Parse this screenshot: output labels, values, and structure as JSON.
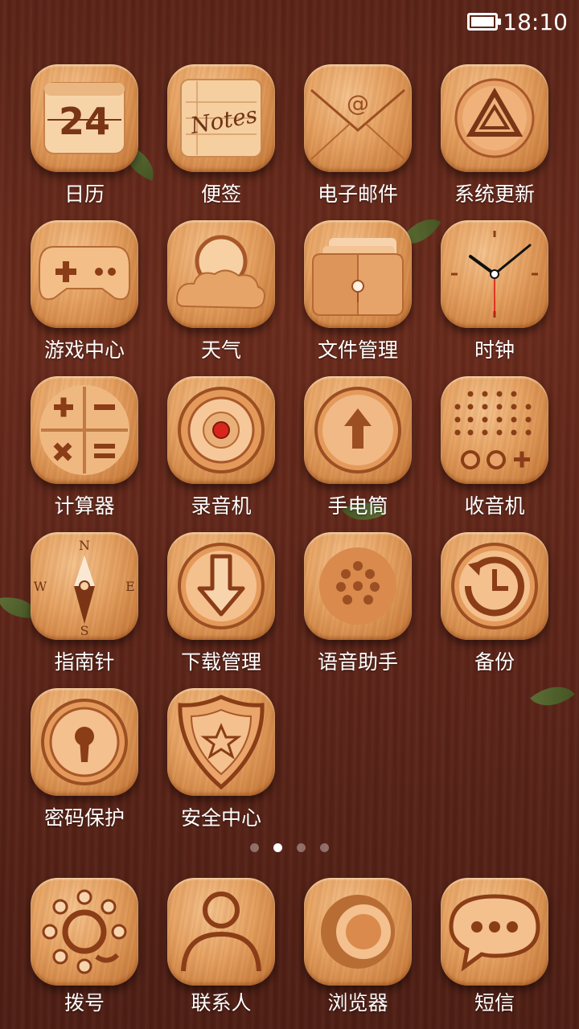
{
  "status_bar": {
    "time": "18:10",
    "battery_icon": "battery-full-icon"
  },
  "apps": [
    {
      "label": "日历",
      "icon": "calendar-icon",
      "badge_text": "24"
    },
    {
      "label": "便签",
      "icon": "notes-icon",
      "badge_text": "Notes"
    },
    {
      "label": "电子邮件",
      "icon": "email-icon",
      "badge_text": "@"
    },
    {
      "label": "系统更新",
      "icon": "system-update-icon"
    },
    {
      "label": "游戏中心",
      "icon": "gamepad-icon"
    },
    {
      "label": "天气",
      "icon": "weather-icon"
    },
    {
      "label": "文件管理",
      "icon": "folder-icon"
    },
    {
      "label": "时钟",
      "icon": "clock-icon"
    },
    {
      "label": "计算器",
      "icon": "calculator-icon"
    },
    {
      "label": "录音机",
      "icon": "recorder-icon"
    },
    {
      "label": "手电筒",
      "icon": "flashlight-icon"
    },
    {
      "label": "收音机",
      "icon": "radio-icon"
    },
    {
      "label": "指南针",
      "icon": "compass-icon",
      "compass": {
        "n": "N",
        "s": "S",
        "e": "E",
        "w": "W"
      }
    },
    {
      "label": "下载管理",
      "icon": "download-icon"
    },
    {
      "label": "语音助手",
      "icon": "voice-assistant-icon"
    },
    {
      "label": "备份",
      "icon": "backup-icon"
    },
    {
      "label": "密码保护",
      "icon": "lock-icon"
    },
    {
      "label": "安全中心",
      "icon": "shield-icon"
    }
  ],
  "page_indicator": {
    "count": 4,
    "active": 2
  },
  "dock": [
    {
      "label": "拨号",
      "icon": "dialer-icon"
    },
    {
      "label": "联系人",
      "icon": "contacts-icon"
    },
    {
      "label": "浏览器",
      "icon": "browser-icon"
    },
    {
      "label": "短信",
      "icon": "messages-icon"
    }
  ],
  "colors": {
    "wood_light": "#f6c48f",
    "wood_dark": "#b86d34",
    "engrave": "#8a3d17",
    "background": "#5e2519"
  }
}
